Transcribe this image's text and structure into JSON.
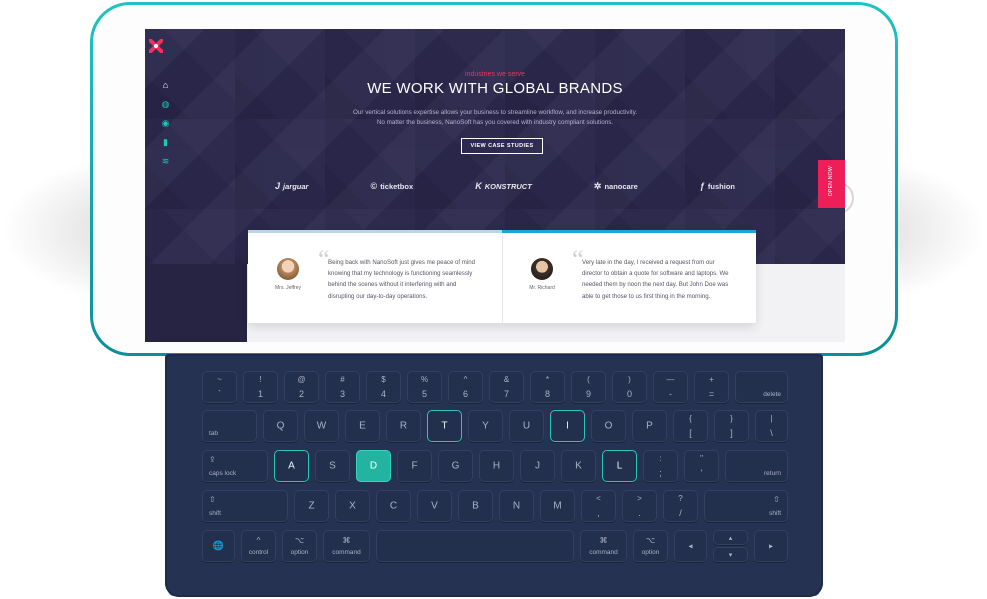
{
  "site": {
    "overline": "industries we serve",
    "headline": "WE WORK WITH GLOBAL BRANDS",
    "description": [
      "Our vertical solutions expertise allows your business to streamline workflow, and increase productivity.",
      "No matter the business, NanoSoft has you covered with industry compliant solutions."
    ],
    "cta_label": "VIEW CASE STUDIES",
    "side_tab": "OPEN NOW",
    "brands": [
      "jarguar",
      "ticketbox",
      "KONSTRUCT",
      "nanocare",
      "fushion"
    ],
    "testimonials": [
      {
        "name": "Mrs. Jeffrey",
        "quote": "Being back with NanoSoft just gives me peace of mind knowing that my technology is functioning seamlessly behind the scenes without it interfering with and disrupting our day-to-day operations."
      },
      {
        "name": "Mr. Richard",
        "quote": "Very late in the day, I received a request from our director to obtain a quote for software and laptops. We needed them by noon the next day. But John Doe was able to get those to us first thing in the morning."
      }
    ]
  },
  "keyboard": {
    "row1": [
      [
        "~",
        "`"
      ],
      [
        "!",
        "1"
      ],
      [
        "@",
        "2"
      ],
      [
        "#",
        "3"
      ],
      [
        "$",
        "4"
      ],
      [
        "%",
        "5"
      ],
      [
        "^",
        "6"
      ],
      [
        "&",
        "7"
      ],
      [
        "*",
        "8"
      ],
      [
        "(",
        "9"
      ],
      [
        ")",
        "0"
      ],
      [
        "—",
        "-"
      ],
      [
        "+",
        "="
      ]
    ],
    "delete": "delete",
    "tab": "tab",
    "row2": [
      "Q",
      "W",
      "E",
      "R",
      "T",
      "Y",
      "U",
      "I",
      "O",
      "P"
    ],
    "row2_brackets": [
      [
        "{",
        "["
      ],
      [
        "}",
        "]"
      ],
      [
        "|",
        "\\"
      ]
    ],
    "caps_lock": "caps lock",
    "row3": [
      "A",
      "S",
      "D",
      "F",
      "G",
      "H",
      "J",
      "K",
      "L"
    ],
    "row3_punct": [
      [
        ":",
        ";"
      ],
      [
        "\"",
        "'"
      ]
    ],
    "return": "return",
    "shift": "shift",
    "row4": [
      "Z",
      "X",
      "C",
      "V",
      "B",
      "N",
      "M"
    ],
    "row4_punct": [
      [
        "<",
        ","
      ],
      [
        ">",
        "."
      ],
      [
        "?",
        "/"
      ]
    ],
    "control": "control",
    "option": "option",
    "command": "command",
    "command_symbol": "⌘",
    "option_symbol": "⌥",
    "control_symbol": "^",
    "shift_symbol": "⇧",
    "caps_symbol": "⇪",
    "globe_symbol": "🌐",
    "arrows": {
      "left": "◂",
      "up": "▴",
      "down": "▾",
      "right": "▸"
    }
  }
}
